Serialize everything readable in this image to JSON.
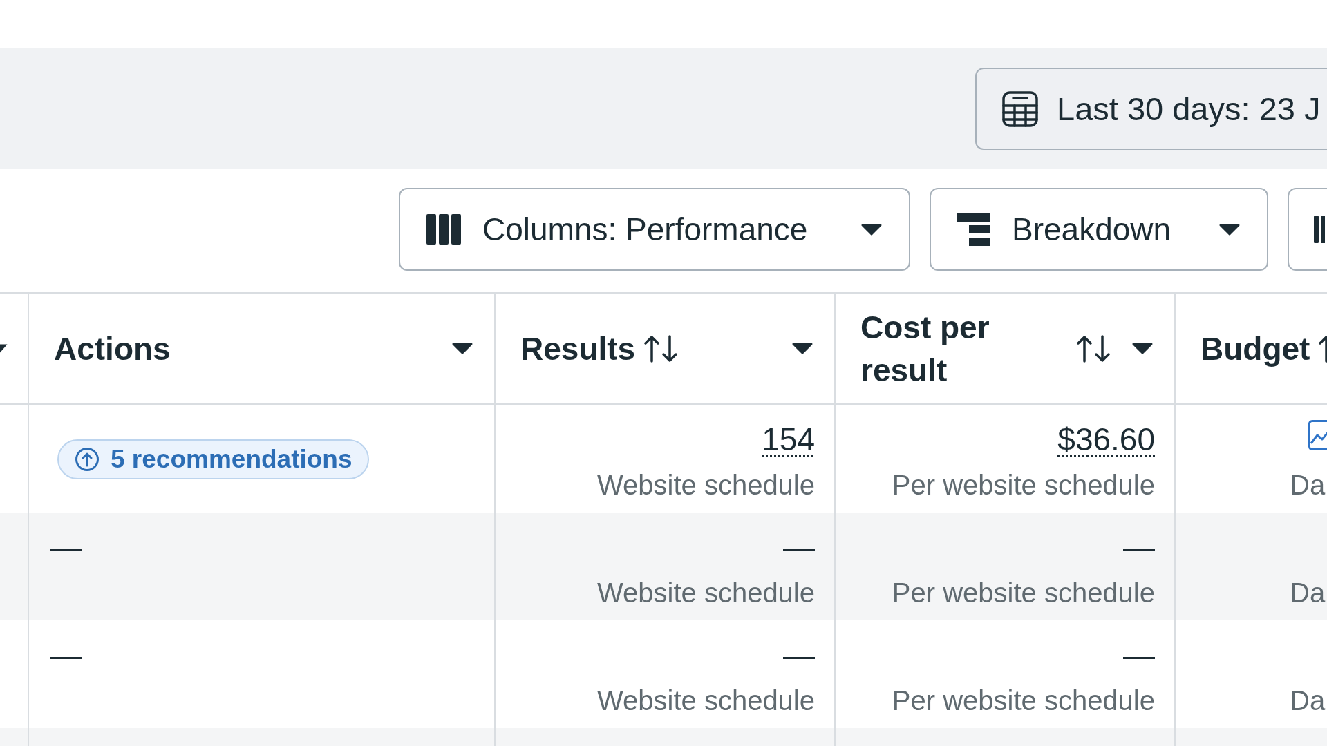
{
  "date_range": {
    "label": "Last 30 days: 23 J"
  },
  "toolbar": [
    {
      "kind": "columns",
      "label": "Columns: Performance",
      "menu": true
    },
    {
      "kind": "breakdown",
      "label": "Breakdown",
      "menu": true
    },
    {
      "kind": "bars",
      "menu": false
    }
  ],
  "table": {
    "columns": [
      {
        "kind": "cut",
        "menu": true
      },
      {
        "kind": "full",
        "label": "Actions",
        "sortable": false,
        "menu": true
      },
      {
        "kind": "full",
        "label": "Results",
        "sortable": true,
        "menu": true
      },
      {
        "kind": "full",
        "label": "Cost per result",
        "sortable": true,
        "menu": true
      },
      {
        "kind": "full",
        "label": "Budget",
        "sortable": true,
        "menu": false
      }
    ],
    "rows": [
      {
        "actions": {
          "kind": "recommendations",
          "label": "5 recommendations"
        },
        "results": {
          "value": "154",
          "underlined": true,
          "unit": "Website schedule"
        },
        "cost_per_result": {
          "value": "$36.60",
          "underlined": true,
          "unit": "Per website schedule"
        },
        "budget": {
          "icon": true,
          "text": "Da"
        }
      },
      {
        "actions": {
          "kind": "empty",
          "label": "—"
        },
        "results": {
          "value": "—",
          "underlined": false,
          "unit": "Website schedule"
        },
        "cost_per_result": {
          "value": "—",
          "underlined": false,
          "unit": "Per website schedule"
        },
        "budget": {
          "icon": false,
          "text": "Da"
        }
      },
      {
        "actions": {
          "kind": "empty",
          "label": "—"
        },
        "results": {
          "value": "—",
          "underlined": false,
          "unit": "Website schedule"
        },
        "cost_per_result": {
          "value": "—",
          "underlined": false,
          "unit": "Per website schedule"
        },
        "budget": {
          "icon": false,
          "text": "Da"
        }
      }
    ]
  }
}
